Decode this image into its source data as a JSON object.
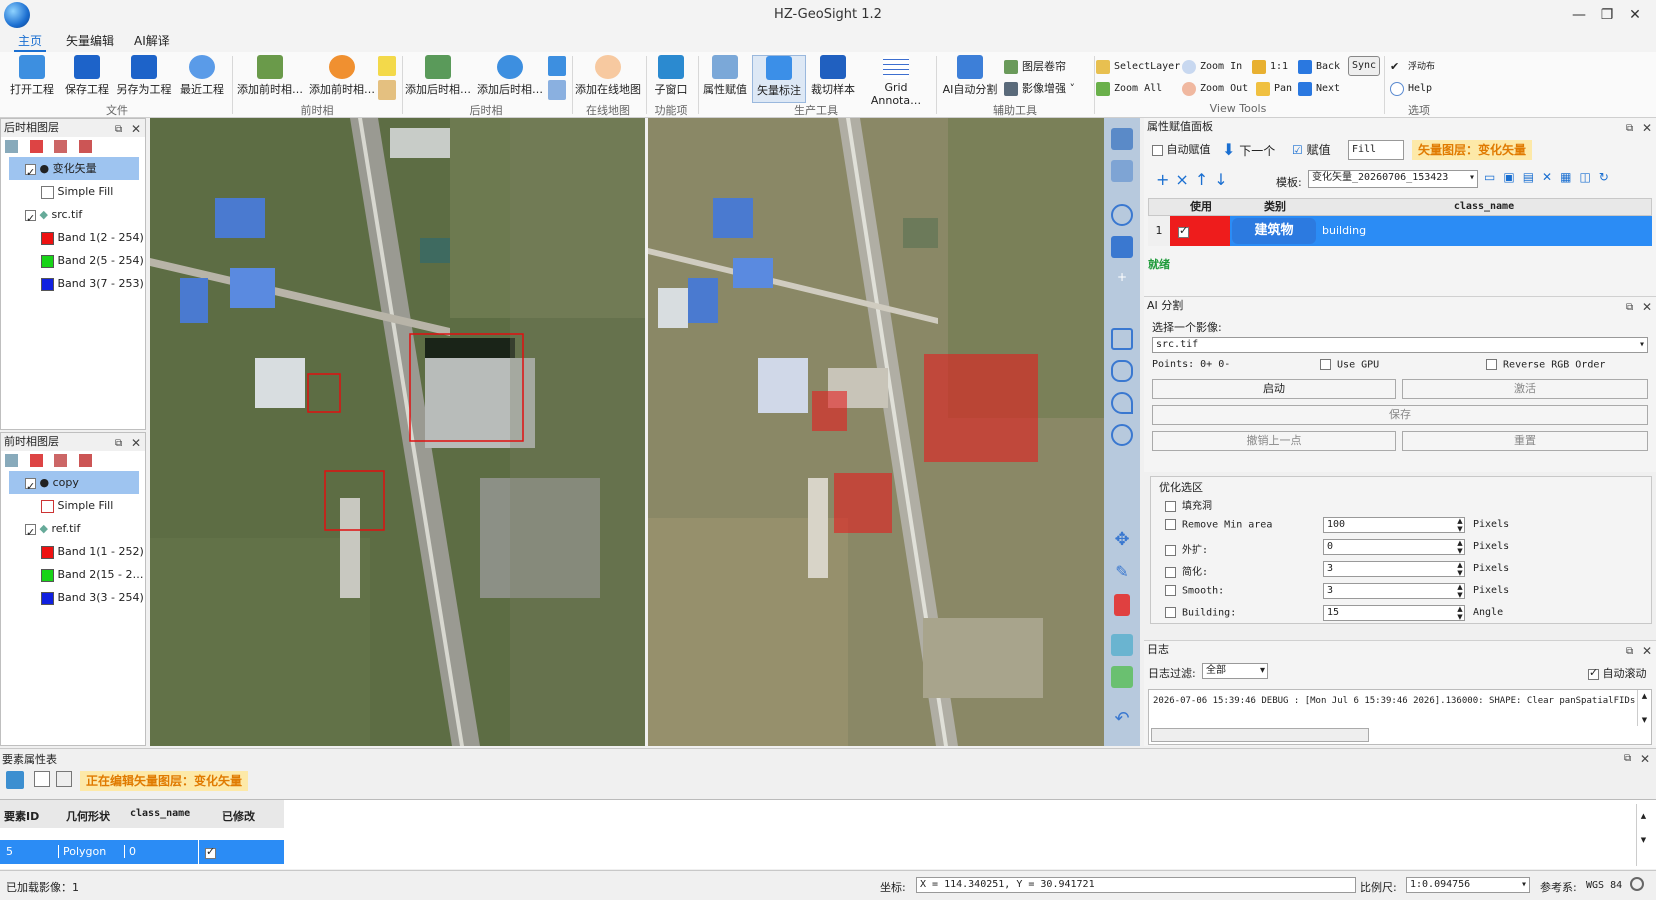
{
  "app": {
    "title": "HZ-GeoSight 1.2"
  },
  "menu": [
    {
      "label": "主页"
    },
    {
      "label": "矢量编辑"
    },
    {
      "label": "AI解译"
    }
  ],
  "ribbon": {
    "buttons": {
      "open": "打开工程",
      "save": "保存工程",
      "saveas": "另存为工程",
      "recent": "最近工程",
      "addpre1": "添加前时相…",
      "addpre2": "添加前时相…",
      "addpost1": "添加后时相…",
      "addpost2": "添加后时相…",
      "online": "添加在线地图",
      "subwin": "子窗口",
      "attr": "属性赋值",
      "vector": "矢量标注",
      "clip": "裁切样本",
      "grid": "Grid Annota…",
      "aiseg": "AI自动分割",
      "layerroll": "图层卷帘",
      "enhance": "影像增强"
    },
    "groups": {
      "file": "文件",
      "pre": "前时相",
      "post": "后时相",
      "online": "在线地图",
      "func": "功能项",
      "prod": "生产工具",
      "aux": "辅助工具",
      "view": "View Tools",
      "options": "选项"
    },
    "viewtools": {
      "selectlayer": "SelectLayer",
      "zoomin": "Zoom In",
      "one": "1:1",
      "back": "Back",
      "sync": "Sync",
      "zoomall": "Zoom All",
      "zoomout": "Zoom Out",
      "pan": "Pan",
      "next": "Next"
    },
    "options": {
      "sw": "浮动布",
      "help": "Help"
    }
  },
  "post_layers": {
    "title": "后时相图层",
    "items": [
      {
        "label": "变化矢量"
      },
      {
        "label": "Simple Fill"
      },
      {
        "label": "src.tif"
      },
      {
        "label": "Band 1(2 - 254)"
      },
      {
        "label": "Band 2(5 - 254)"
      },
      {
        "label": "Band 3(7 - 253)"
      }
    ]
  },
  "pre_layers": {
    "title": "前时相图层",
    "items": [
      {
        "label": "copy"
      },
      {
        "label": "Simple Fill"
      },
      {
        "label": "ref.tif"
      },
      {
        "label": "Band 1(1 - 252)"
      },
      {
        "label": "Band 2(15 - 2…"
      },
      {
        "label": "Band 3(3 - 254)"
      }
    ]
  },
  "colors": {
    "band_red": "#ee1111",
    "band_green": "#18d418",
    "band_blue": "#1020e0",
    "select": "#1e90ff",
    "accent": "#e07a00"
  },
  "attr_panel": {
    "title": "属性赋值面板",
    "auto": "自动赋值",
    "next": "下一个",
    "assign": "赋值",
    "fill_value": "Fill",
    "layer_label": "矢量图层：变化矢量",
    "template_label": "模板:",
    "template_value": "变化矢量_20260706_153423",
    "cols": [
      "使用",
      "类别",
      "class_name"
    ],
    "row": {
      "idx": "1",
      "category": "建筑物",
      "class_name": "building"
    },
    "status": "就绪"
  },
  "ai_seg": {
    "title": "AI 分割",
    "select_label": "选择一个影像:",
    "image_value": "src.tif",
    "points": "Points: 0+ 0-",
    "use_gpu": "Use GPU",
    "reverse_rgb": "Reverse RGB Order",
    "start": "启动",
    "activate": "激活",
    "save": "保存",
    "undo": "撤销上一点",
    "reset": "重置"
  },
  "optimize": {
    "title": "优化选区",
    "rows": [
      {
        "label": "填充洞",
        "value": "",
        "unit": ""
      },
      {
        "label": "Remove Min area",
        "value": "100",
        "unit": "Pixels"
      },
      {
        "label": "外扩:",
        "value": "0",
        "unit": "Pixels"
      },
      {
        "label": "简化:",
        "value": "3",
        "unit": "Pixels"
      },
      {
        "label": "Smooth:",
        "value": "3",
        "unit": "Pixels"
      },
      {
        "label": "Building:",
        "value": "15",
        "unit": "Angle"
      }
    ]
  },
  "log": {
    "title": "日志",
    "filter_label": "日志过滤:",
    "filter_value": "全部",
    "autoscroll": "自动滚动",
    "line": "2026-07-06 15:39:46 DEBUG  : [Mon Jul  6 15:39:46 2026].136000: SHAPE: Clear panSpatialFIDs"
  },
  "feature_table": {
    "title": "要素属性表",
    "editing": "正在编辑矢量图层：变化矢量",
    "cols": [
      "要素ID",
      "几何形状",
      "class_name",
      "已修改"
    ],
    "row": {
      "id": "5",
      "geom": "Polygon",
      "class_name": "0"
    }
  },
  "statusbar": {
    "loaded": "已加载影像：1",
    "coord_label": "坐标:",
    "coord_value": "X = 114.340251, Y = 30.941721",
    "scale_label": "比例尺:",
    "scale_value": "1:0.094756",
    "ref_label": "参考系:",
    "ref_value": "WGS 84"
  }
}
